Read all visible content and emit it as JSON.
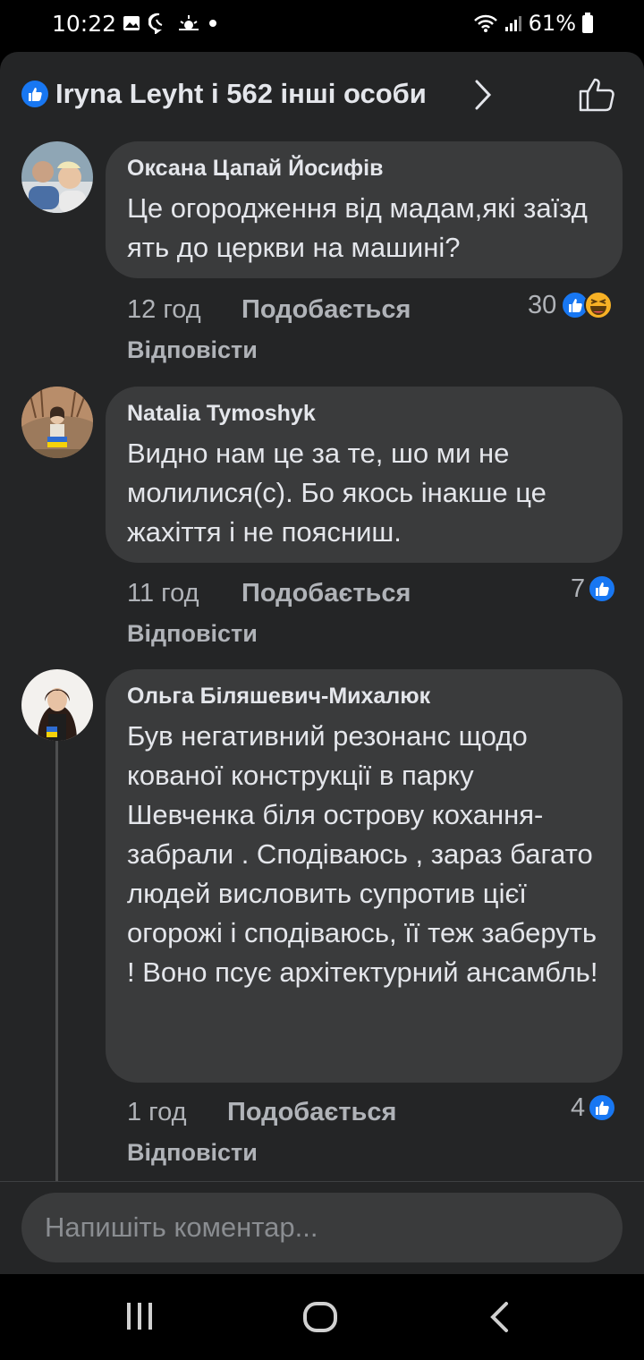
{
  "status_bar": {
    "time": "10:22",
    "battery": "61%"
  },
  "header": {
    "reactors": "Iryna Leyht і 562 інші особи"
  },
  "comments": [
    {
      "author": "Оксана Цапай Йосифів",
      "text": "Це огородження від мадам,які заїзд ять до церкви на машині?",
      "time": "12 год",
      "like": "Подобається",
      "reply": "Відповісти",
      "reactions": "30"
    },
    {
      "author": "Natalia Tymoshyk",
      "text": "Видно нам це за те, шо ми не молилися(с). Бо якось інакше це жахіття і не поясниш.",
      "time": "11 год",
      "like": "Подобається",
      "reply": "Відповісти",
      "reactions": "7"
    },
    {
      "author": "Ольга Біляшевич-Михалюк",
      "text": "Був негативний резонанс щодо кованої конструкції в парку Шевченка біля острову кохання- забрали . Сподіваюсь , зараз багато людей висловить супротив цієї огорожі і сподіваюсь, її теж заберуть ! Воно псує архітектурний ансамбль!",
      "time": "1 год",
      "like": "Подобається",
      "reply": "Відповісти",
      "reactions": "4"
    }
  ],
  "composer": {
    "placeholder": "Напишіть коментар..."
  },
  "colors": {
    "background": "#242526",
    "bubble": "#3a3b3c",
    "like_blue": "#1877f2",
    "haha_yellow": "#f7b125",
    "text_primary": "#e4e6eb",
    "text_secondary": "#b0b3b8"
  },
  "icons": {
    "header_badge": "like-badge-icon",
    "header_chevron": "chevron-right-icon",
    "header_like": "thumbs-up-outline-icon",
    "reaction_like": "like-reaction-icon",
    "reaction_haha": "haha-reaction-icon",
    "nav_recents": "recents-icon",
    "nav_home": "home-icon",
    "nav_back": "back-icon"
  }
}
